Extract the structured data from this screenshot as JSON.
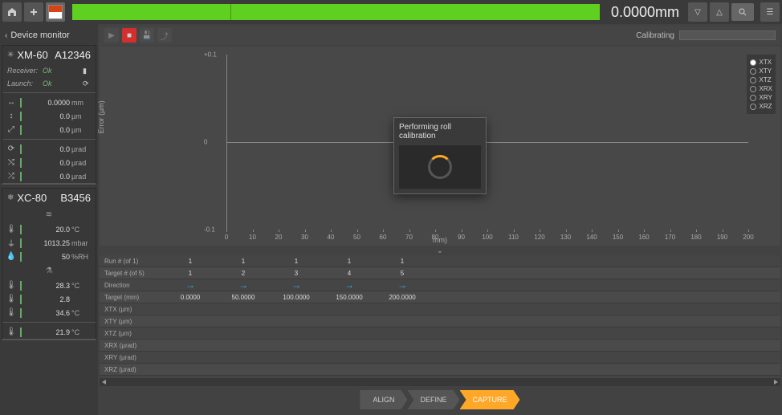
{
  "topbar": {
    "readout": "0.0000mm"
  },
  "sidebar": {
    "title": "Device monitor",
    "devices": [
      {
        "name": "XM-60",
        "serial": "A12346",
        "status": [
          {
            "label": "Receiver:",
            "value": "Ok"
          },
          {
            "label": "Launch:",
            "value": "Ok"
          }
        ],
        "measurements": [
          {
            "icon": "↔",
            "value": "0.0000",
            "unit": "mm"
          },
          {
            "icon": "↕",
            "value": "0.0",
            "unit": "µm"
          },
          {
            "icon": "⤢",
            "value": "0.0",
            "unit": "µm"
          },
          {
            "icon": "⟳",
            "value": "0.0",
            "unit": "µrad"
          },
          {
            "icon": "⤭",
            "value": "0.0",
            "unit": "µrad"
          },
          {
            "icon": "⤮",
            "value": "0.0",
            "unit": "µrad"
          }
        ]
      },
      {
        "name": "XC-80",
        "serial": "B3456",
        "env": [
          {
            "icon": "🌡",
            "value": "20.0",
            "unit": "°C"
          },
          {
            "icon": "⏚",
            "value": "1013.25",
            "unit": "mbar"
          },
          {
            "icon": "💧",
            "value": "50",
            "unit": "%RH"
          },
          {
            "icon": "🌡",
            "value": "28.3",
            "unit": "°C"
          },
          {
            "icon": "🌡",
            "value": "2.8",
            "unit": ""
          },
          {
            "icon": "🌡",
            "value": "34.6",
            "unit": "°C"
          },
          {
            "icon": "🌡",
            "value": "21.9",
            "unit": "°C"
          }
        ]
      }
    ]
  },
  "chart_data": {
    "type": "line",
    "title": "",
    "xlabel": "mm)",
    "ylabel": "Error (µm)",
    "xlim": [
      0,
      200
    ],
    "ylim": [
      -0.1,
      0.1
    ],
    "xticks": [
      0,
      10,
      20,
      30,
      40,
      50,
      60,
      70,
      80,
      90,
      100,
      110,
      120,
      130,
      140,
      150,
      160,
      170,
      180,
      190,
      200
    ],
    "yticks": [
      -0.1,
      0,
      0.1
    ],
    "ytick_labels": [
      "-0.1",
      "0",
      "+0.1"
    ],
    "series": [
      {
        "name": "XTX",
        "values": []
      },
      {
        "name": "XTY",
        "values": []
      },
      {
        "name": "XTZ",
        "values": []
      },
      {
        "name": "XRX",
        "values": []
      },
      {
        "name": "XRY",
        "values": []
      },
      {
        "name": "XRZ",
        "values": []
      }
    ],
    "selected_series": "XTX"
  },
  "toolbar": {
    "calibrating_label": "Calibrating"
  },
  "modal": {
    "message": "Performing roll calibration"
  },
  "table": {
    "rows": [
      {
        "header": "Run # (of 1)",
        "cells": [
          "1",
          "1",
          "1",
          "1",
          "1"
        ]
      },
      {
        "header": "Target # (of 5)",
        "cells": [
          "1",
          "2",
          "3",
          "4",
          "5"
        ]
      },
      {
        "header": "Direction",
        "cells": [
          "→",
          "→",
          "→",
          "→",
          "→"
        ],
        "arrow": true
      },
      {
        "header": "Target (mm)",
        "cells": [
          "0.0000",
          "50.0000",
          "100.0000",
          "150.0000",
          "200.0000"
        ]
      },
      {
        "header": "XTX (µm)",
        "cells": [
          "",
          "",
          "",
          "",
          ""
        ]
      },
      {
        "header": "XTY (µm)",
        "cells": [
          "",
          "",
          "",
          "",
          ""
        ]
      },
      {
        "header": "XTZ (µm)",
        "cells": [
          "",
          "",
          "",
          "",
          ""
        ]
      },
      {
        "header": "XRX (µrad)",
        "cells": [
          "",
          "",
          "",
          "",
          ""
        ]
      },
      {
        "header": "XRY (µrad)",
        "cells": [
          "",
          "",
          "",
          "",
          ""
        ]
      },
      {
        "header": "XRZ (µrad)",
        "cells": [
          "",
          "",
          "",
          "",
          ""
        ]
      }
    ]
  },
  "stepper": {
    "steps": [
      "ALIGN",
      "DEFINE",
      "CAPTURE"
    ],
    "active": 2
  }
}
